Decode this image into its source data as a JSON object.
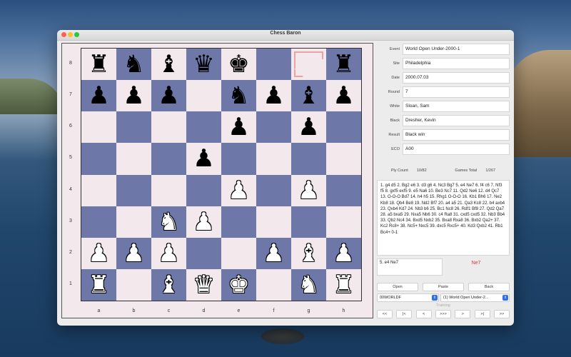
{
  "window": {
    "title": "Chess Baron"
  },
  "board": {
    "ranks": [
      "8",
      "7",
      "6",
      "5",
      "4",
      "3",
      "2",
      "1"
    ],
    "files": [
      "a",
      "b",
      "c",
      "d",
      "e",
      "f",
      "g",
      "h"
    ],
    "rows": [
      [
        "bR",
        "bN",
        "bB",
        "bQ",
        "bK",
        "",
        "",
        "bR"
      ],
      [
        "bP",
        "bP",
        "bP",
        "",
        "bN",
        "bP",
        "bB",
        "bP"
      ],
      [
        "",
        "",
        "",
        "",
        "bP",
        "",
        "bP",
        ""
      ],
      [
        "",
        "",
        "",
        "bP",
        "",
        "",
        "",
        ""
      ],
      [
        "",
        "",
        "",
        "",
        "wP",
        "",
        "wP",
        ""
      ],
      [
        "",
        "",
        "wN",
        "wP",
        "",
        "",
        "",
        ""
      ],
      [
        "wP",
        "wP",
        "wP",
        "",
        "",
        "wP",
        "wB",
        "wP"
      ],
      [
        "wR",
        "",
        "wB",
        "wQ",
        "wK",
        "",
        "wN",
        "wR"
      ]
    ],
    "selected_square": "g8",
    "colors": {
      "light": "#f3e8eb",
      "dark": "#6e78a8"
    }
  },
  "game_info": [
    {
      "label": "Event",
      "value": "World Open Under-2000-1"
    },
    {
      "label": "Site",
      "value": "Philadelphia"
    },
    {
      "label": "Date",
      "value": "2000.07.03"
    },
    {
      "label": "Round",
      "value": "7"
    },
    {
      "label": "White",
      "value": "Sloan, Sam"
    },
    {
      "label": "Black",
      "value": "Dresher, Kevin"
    },
    {
      "label": "Result",
      "value": "Black win"
    },
    {
      "label": "ECO",
      "value": "A00"
    }
  ],
  "counts": {
    "ply_label": "Ply Count",
    "ply_value": "10/82",
    "games_label": "Games Total",
    "games_value": "1/267"
  },
  "moves_text": "1. g4 d5 2. Bg2 e6 3. d3 g6 4. Nc3 Bg7 5. e4 Ne7 6. f4 c6 7. Nf3 f5 8. gxf5 exf5 9. e5 Na6 10. Be3 Nc7 11. Qd2 Ne6 12. d4 Qc7 13. O-O-O Bd7 14. h4 h5 15. Rhg1 O-O-O 16. Kb1 Bh6 17. Ne2 Kb8 18. Qb4 Be8 19. Nd2 Bf7 20. a4 a5 21. Qa3 Kc8 22. b4 axb4 23. Qxb4 Kd7 24. Nb3 b6 25. Bc1 Nc8 26. Rdf1 Bf8 27. Qd2 Qa7 28. a5 bxa5 29. Nxa5 Nb6 30. c4 Ra8 31. cxd5 cxd5 32. Nb3 Bb4 33. Qb2 Nc4 34. Bxd5 Nxb2 35. Bxa8 Rxa8 36. Bxb2 Qa2+ 37. Kc2 Rc8+ 38. Nc5+ Nxc5 39. dxc5 Rxc5+ 40. Kd3 Qxb2 41. Rb1 Bc4+ 0-1",
  "move_input": "5. e4 Ne7",
  "next_move": "Ne7",
  "buttons": {
    "open": "Open",
    "paste": "Paste",
    "back": "Back"
  },
  "selects": {
    "database": "00WORLDF",
    "game": "(1) World Open Under-2..."
  },
  "training": "Training",
  "nav": [
    "<<",
    "|<",
    "<",
    ">>>",
    ">",
    ">|",
    ">>"
  ]
}
